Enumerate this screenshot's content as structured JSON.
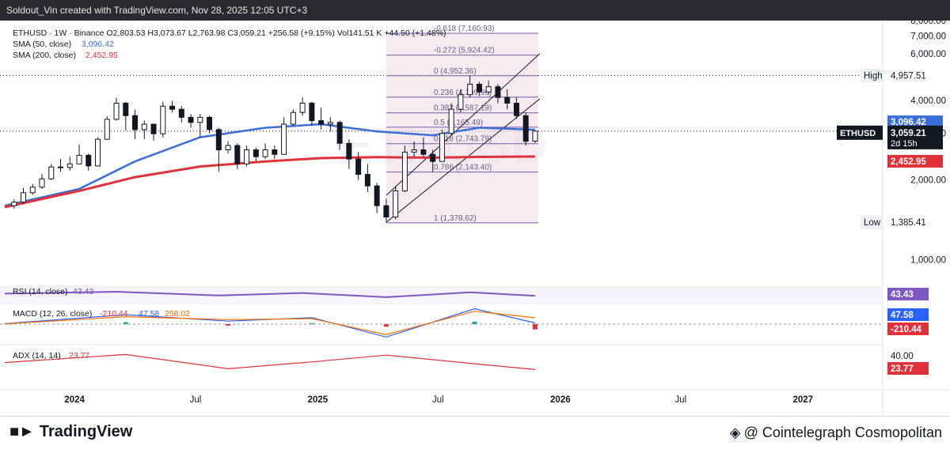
{
  "header": {
    "credit": "Soldout_Vin created with TradingView.com, Nov 28, 2025 12:05 UTC+3"
  },
  "legend": {
    "ohlc": "ETHUSD · 1W · Binance  O2,803.53  H3,073.67  L2,763.98  C3,059.21  +256.58 (+9.15%)  Vol141.51 K  +44.50 (+1.48%)",
    "sma50_label": "SMA (50, close)",
    "sma50_value": "3,096.42",
    "sma200_label": "SMA (200, close)",
    "sma200_value": "2,452.95",
    "rsi_label": "RSI (14, close)",
    "rsi_value": "43.43",
    "macd_label": "MACD (12, 26, close)",
    "macd_values": [
      "-210.44",
      "47.58",
      "258.02"
    ],
    "adx_label": "ADX (14, 14)",
    "adx_value": "23.77"
  },
  "watermark_symbol": "ETHUSD",
  "colors": {
    "up": "#26a69a",
    "down": "#131722",
    "sma50": "#3b6fd8",
    "sma200": "#e0323a",
    "rsi": "#7e57c2",
    "macd": "#2962ff",
    "signal": "#ff6d00",
    "adx": "#e0323a",
    "fib_zone": "#f3d9e6"
  },
  "price_labels": {
    "high_label": "High",
    "high_value": "4,957.51",
    "low_label": "Low",
    "low_value": "1,385.41",
    "sma50_badge": "3,096.42",
    "sma200_badge": "2,452.95",
    "symbol_badge": "ETHUSD",
    "last_price": "3,059.21",
    "countdown": "2d 15h",
    "rsi_badge": "43.43",
    "macd_badge": "47.58",
    "macd_hist_badge": "-210.44",
    "adx_badge": "23.77",
    "adx_axis_tick": "40.00"
  },
  "footer": {
    "brand": "TradingView",
    "watermark": "@ Cointelegraph Cosmopolitan"
  },
  "chart_data": [
    {
      "type": "candlestick",
      "title": "ETHUSD · 1W · Binance",
      "scale": "log",
      "ylim": [
        800,
        8000
      ],
      "y_ticks": [
        "1,000.00",
        "2,000.00",
        "3,000.00",
        "4,000.00",
        "6,000.00",
        "7,000.00",
        "8,000.00"
      ],
      "x_ticks": [
        "2024",
        "Jul",
        "2025",
        "Jul",
        "2026",
        "Jul",
        "2027"
      ],
      "xlim": [
        "2023-09-18",
        "2027-05-01"
      ],
      "grid": false,
      "last": {
        "open": 2803.53,
        "high": 3073.67,
        "low": 2763.98,
        "close": 3059.21
      },
      "candles": [
        {
          "t": "2023-10-02",
          "o": 1600,
          "h": 1690,
          "l": 1560,
          "c": 1650
        },
        {
          "t": "2023-10-16",
          "o": 1650,
          "h": 1870,
          "l": 1620,
          "c": 1790
        },
        {
          "t": "2023-10-30",
          "o": 1790,
          "h": 1930,
          "l": 1760,
          "c": 1880
        },
        {
          "t": "2023-11-13",
          "o": 1880,
          "h": 2110,
          "l": 1850,
          "c": 2020
        },
        {
          "t": "2023-11-27",
          "o": 2020,
          "h": 2300,
          "l": 2000,
          "c": 2240
        },
        {
          "t": "2023-12-11",
          "o": 2240,
          "h": 2400,
          "l": 2150,
          "c": 2230
        },
        {
          "t": "2023-12-25",
          "o": 2230,
          "h": 2450,
          "l": 2170,
          "c": 2300
        },
        {
          "t": "2024-01-08",
          "o": 2300,
          "h": 2720,
          "l": 2300,
          "c": 2480
        },
        {
          "t": "2024-01-22",
          "o": 2480,
          "h": 2520,
          "l": 2170,
          "c": 2260
        },
        {
          "t": "2024-02-05",
          "o": 2260,
          "h": 2900,
          "l": 2250,
          "c": 2850
        },
        {
          "t": "2024-02-19",
          "o": 2850,
          "h": 3480,
          "l": 2850,
          "c": 3390
        },
        {
          "t": "2024-03-04",
          "o": 3390,
          "h": 4090,
          "l": 3350,
          "c": 3900
        },
        {
          "t": "2024-03-18",
          "o": 3900,
          "h": 3950,
          "l": 3080,
          "c": 3500
        },
        {
          "t": "2024-04-01",
          "o": 3500,
          "h": 3680,
          "l": 2850,
          "c": 3100
        },
        {
          "t": "2024-04-15",
          "o": 3100,
          "h": 3350,
          "l": 2850,
          "c": 3250
        },
        {
          "t": "2024-04-29",
          "o": 3250,
          "h": 3200,
          "l": 2820,
          "c": 2990
        },
        {
          "t": "2024-05-13",
          "o": 2990,
          "h": 3950,
          "l": 2900,
          "c": 3800
        },
        {
          "t": "2024-05-27",
          "o": 3800,
          "h": 3980,
          "l": 3600,
          "c": 3700
        },
        {
          "t": "2024-06-10",
          "o": 3700,
          "h": 3800,
          "l": 3300,
          "c": 3450
        },
        {
          "t": "2024-06-24",
          "o": 3450,
          "h": 3550,
          "l": 3150,
          "c": 3300
        },
        {
          "t": "2024-07-08",
          "o": 3300,
          "h": 3550,
          "l": 2900,
          "c": 3450
        },
        {
          "t": "2024-07-22",
          "o": 3450,
          "h": 3500,
          "l": 3000,
          "c": 3100
        },
        {
          "t": "2024-08-05",
          "o": 3100,
          "h": 3150,
          "l": 2150,
          "c": 2600
        },
        {
          "t": "2024-08-19",
          "o": 2600,
          "h": 2800,
          "l": 2520,
          "c": 2700
        },
        {
          "t": "2024-09-02",
          "o": 2700,
          "h": 2750,
          "l": 2200,
          "c": 2300
        },
        {
          "t": "2024-09-16",
          "o": 2300,
          "h": 2700,
          "l": 2250,
          "c": 2600
        },
        {
          "t": "2024-09-30",
          "o": 2600,
          "h": 2650,
          "l": 2350,
          "c": 2450
        },
        {
          "t": "2024-10-14",
          "o": 2450,
          "h": 2750,
          "l": 2400,
          "c": 2600
        },
        {
          "t": "2024-10-28",
          "o": 2600,
          "h": 2700,
          "l": 2400,
          "c": 2500
        },
        {
          "t": "2024-11-11",
          "o": 2500,
          "h": 3450,
          "l": 2500,
          "c": 3250
        },
        {
          "t": "2024-11-25",
          "o": 3250,
          "h": 3700,
          "l": 3200,
          "c": 3600
        },
        {
          "t": "2024-12-09",
          "o": 3600,
          "h": 4100,
          "l": 3500,
          "c": 3900
        },
        {
          "t": "2024-12-23",
          "o": 3900,
          "h": 3950,
          "l": 3200,
          "c": 3350
        },
        {
          "t": "2025-01-06",
          "o": 3350,
          "h": 3750,
          "l": 3100,
          "c": 3250
        },
        {
          "t": "2025-01-20",
          "o": 3250,
          "h": 3450,
          "l": 3050,
          "c": 3300
        },
        {
          "t": "2025-02-03",
          "o": 3300,
          "h": 3350,
          "l": 2600,
          "c": 2750
        },
        {
          "t": "2025-02-17",
          "o": 2750,
          "h": 2850,
          "l": 2200,
          "c": 2400
        },
        {
          "t": "2025-03-03",
          "o": 2400,
          "h": 2550,
          "l": 2000,
          "c": 2100
        },
        {
          "t": "2025-03-17",
          "o": 2100,
          "h": 2300,
          "l": 1800,
          "c": 1900
        },
        {
          "t": "2025-03-31",
          "o": 1900,
          "h": 1950,
          "l": 1500,
          "c": 1600
        },
        {
          "t": "2025-04-14",
          "o": 1600,
          "h": 1700,
          "l": 1385.41,
          "c": 1450
        },
        {
          "t": "2025-04-28",
          "o": 1450,
          "h": 1900,
          "l": 1420,
          "c": 1820
        },
        {
          "t": "2025-05-12",
          "o": 1820,
          "h": 2700,
          "l": 1800,
          "c": 2550
        },
        {
          "t": "2025-05-26",
          "o": 2550,
          "h": 2800,
          "l": 2450,
          "c": 2600
        },
        {
          "t": "2025-06-09",
          "o": 2600,
          "h": 2900,
          "l": 2450,
          "c": 2500
        },
        {
          "t": "2025-06-23",
          "o": 2500,
          "h": 2600,
          "l": 2150,
          "c": 2350
        },
        {
          "t": "2025-07-07",
          "o": 2350,
          "h": 3100,
          "l": 2350,
          "c": 3000
        },
        {
          "t": "2025-07-21",
          "o": 3000,
          "h": 3900,
          "l": 2950,
          "c": 3700
        },
        {
          "t": "2025-08-04",
          "o": 3700,
          "h": 4400,
          "l": 3600,
          "c": 4200
        },
        {
          "t": "2025-08-18",
          "o": 4200,
          "h": 4957.51,
          "l": 4100,
          "c": 4600
        },
        {
          "t": "2025-09-01",
          "o": 4600,
          "h": 4700,
          "l": 4150,
          "c": 4300
        },
        {
          "t": "2025-09-15",
          "o": 4300,
          "h": 4750,
          "l": 4200,
          "c": 4500
        },
        {
          "t": "2025-09-29",
          "o": 4500,
          "h": 4600,
          "l": 3900,
          "c": 4100
        },
        {
          "t": "2025-10-13",
          "o": 4100,
          "h": 4400,
          "l": 3700,
          "c": 3900
        },
        {
          "t": "2025-10-27",
          "o": 3900,
          "h": 4100,
          "l": 3400,
          "c": 3500
        },
        {
          "t": "2025-11-10",
          "o": 3500,
          "h": 3600,
          "l": 2700,
          "c": 2800
        },
        {
          "t": "2025-11-24",
          "o": 2803.53,
          "h": 3073.67,
          "l": 2763.98,
          "c": 3059.21
        }
      ]
    },
    {
      "type": "line",
      "title": "Moving averages",
      "series": [
        {
          "name": "SMA (50, close)",
          "last": 3096.42,
          "x": [
            "2023-09-18",
            "2024-01-08",
            "2024-04-01",
            "2024-07-08",
            "2024-10-14",
            "2025-01-06",
            "2025-03-31",
            "2025-06-23",
            "2025-09-01",
            "2025-11-24"
          ],
          "y": [
            1600,
            1850,
            2350,
            2900,
            3150,
            3250,
            3050,
            2950,
            3150,
            3096.42
          ]
        },
        {
          "name": "SMA (200, close)",
          "last": 2452.95,
          "x": [
            "2023-09-18",
            "2024-01-08",
            "2024-04-01",
            "2024-07-08",
            "2024-10-14",
            "2025-01-06",
            "2025-03-31",
            "2025-06-23",
            "2025-09-01",
            "2025-11-24"
          ],
          "y": [
            1580,
            1820,
            2050,
            2250,
            2350,
            2420,
            2440,
            2430,
            2445,
            2452.95
          ]
        }
      ]
    },
    {
      "type": "fib",
      "title": "Fib retracement",
      "start": "2025-04-14",
      "end": "2025-11-24",
      "levels": [
        {
          "ratio": "-0.618",
          "price": 7160.93,
          "label": "-0.618 (7,160.93)"
        },
        {
          "ratio": "-0.272",
          "price": 5924.42,
          "label": "-0.272 (5,924.42)"
        },
        {
          "ratio": "0",
          "price": 4952.36,
          "label": "0 (4,952.36)"
        },
        {
          "ratio": "0.236",
          "price": 4109.96,
          "label": "0.236 (4,109.96)"
        },
        {
          "ratio": "0.382",
          "price": 3587.19,
          "label": "0.382 (3,587.19)"
        },
        {
          "ratio": "0.5",
          "price": 3165.49,
          "label": "0.5 (3,165.49)"
        },
        {
          "ratio": "0.618",
          "price": 2743.79,
          "label": "0.618 (2,743.79)"
        },
        {
          "ratio": "0.786",
          "price": 2143.4,
          "label": "0.786 (2,143.40)"
        },
        {
          "ratio": "1",
          "price": 1378.62,
          "label": "1 (1,378.62)"
        }
      ],
      "channel": {
        "upper": [
          {
            "t": "2025-04-14",
            "y": 1750
          },
          {
            "t": "2025-12-01",
            "y": 6000
          }
        ],
        "lower": [
          {
            "t": "2025-04-14",
            "y": 1385.41
          },
          {
            "t": "2025-12-01",
            "y": 4050
          }
        ]
      }
    },
    {
      "type": "line",
      "title": "RSI (14, close)",
      "ylim": [
        0,
        100
      ],
      "series": [
        {
          "name": "RSI (14, close)",
          "last": 43.43,
          "x": [
            "2023-09-18",
            "2024-03-04",
            "2024-08-05",
            "2024-12-09",
            "2025-04-14",
            "2025-08-18",
            "2025-11-24"
          ],
          "y": [
            60,
            75,
            45,
            65,
            32,
            70,
            43.43
          ]
        }
      ]
    },
    {
      "type": "line",
      "title": "MACD (12, 26, close)",
      "series": [
        {
          "name": "MACD",
          "last": 47.58,
          "x": [
            "2023-09-18",
            "2024-03-18",
            "2024-08-19",
            "2024-12-23",
            "2025-04-14",
            "2025-08-25",
            "2025-11-24"
          ],
          "y": [
            20,
            380,
            120,
            260,
            -520,
            620,
            47.58
          ]
        },
        {
          "name": "Signal",
          "last": 258.02,
          "x": [
            "2023-09-18",
            "2024-03-18",
            "2024-08-19",
            "2024-12-23",
            "2025-04-14",
            "2025-08-25",
            "2025-11-24"
          ],
          "y": [
            10,
            300,
            180,
            220,
            -420,
            520,
            258.02
          ]
        },
        {
          "name": "Histogram",
          "last": -210.44,
          "x": [
            "2023-09-18",
            "2024-03-18",
            "2024-08-19",
            "2024-12-23",
            "2025-04-14",
            "2025-08-25",
            "2025-11-24"
          ],
          "y": [
            10,
            80,
            -60,
            40,
            -100,
            100,
            -210.44
          ]
        }
      ]
    },
    {
      "type": "line",
      "title": "ADX (14, 14)",
      "series": [
        {
          "name": "ADX (14, 14)",
          "last": 23.77,
          "x": [
            "2023-09-18",
            "2024-03-18",
            "2024-08-19",
            "2024-12-23",
            "2025-04-14",
            "2025-08-25",
            "2025-11-24"
          ],
          "y": [
            35,
            48,
            25,
            36,
            47,
            33,
            23.77
          ]
        }
      ]
    }
  ]
}
